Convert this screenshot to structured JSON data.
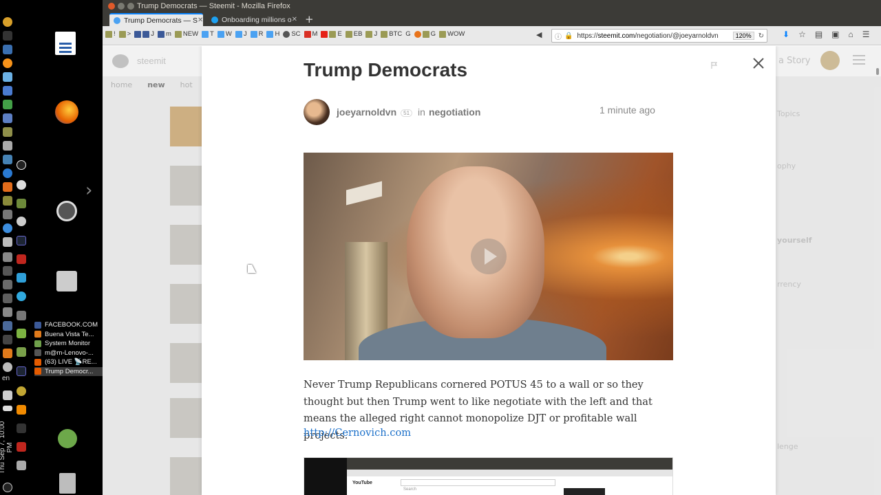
{
  "window": {
    "title": "Trump Democrats — Steemit - Mozilla Firefox"
  },
  "tabs": [
    {
      "label": "Trump Democrats — S"
    },
    {
      "label": "Onboarding millions o"
    }
  ],
  "bookmarks": [
    "!",
    ">",
    "J",
    "m",
    "NEW",
    "T",
    "W",
    "J",
    "R",
    "H",
    "SC",
    "M",
    "E",
    "EB",
    "J",
    "BTC",
    "G",
    "G",
    "WOW"
  ],
  "urlbar": {
    "url_prefix": "https://",
    "url_domain": "steemit.com",
    "url_path": "/negotiation/@joeyarnoldvn",
    "zoom": "120%"
  },
  "dock": {
    "windows": [
      {
        "label": "FACEBOOK.COM",
        "color": "#3b5998"
      },
      {
        "label": "Buena Vista Te...",
        "color": "#e07a1b"
      },
      {
        "label": "System Monitor",
        "color": "#6fa04b"
      },
      {
        "label": "m@m-Lenovo-...",
        "color": "#555555"
      },
      {
        "label": "(63) LIVE 📡RE...",
        "color": "#e55b00"
      },
      {
        "label": "Trump Democr...",
        "color": "#e55b00"
      }
    ],
    "lang": "en",
    "clock": "Thu Sep 7, 10:00 PM"
  },
  "background": {
    "brand": "steemit",
    "nav": [
      "home",
      "new",
      "hot"
    ],
    "story": "a Story",
    "sidebar": [
      "Topics",
      "ophy",
      "yourself",
      "rrency",
      "lenge"
    ]
  },
  "post": {
    "title": "Trump Democrats",
    "author": "joeyarnoldvn",
    "reputation": "51",
    "in_label": "in",
    "category": "negotiation",
    "time_ago": "1 minute ago",
    "body": "Never Trump Republicans cornered POTUS 45 to a wall or so they thought but then Trump went to like negotiate with the left and that means the alleged right cannot monopolize DJT or profitable wall projects.",
    "link": "http://Cernovich.com",
    "embedded_label": "YouTube",
    "embedded_search": "Search"
  },
  "colors": {
    "link": "#1a6fc9",
    "title": "#333333",
    "tab_accent": "#0a84ff"
  }
}
